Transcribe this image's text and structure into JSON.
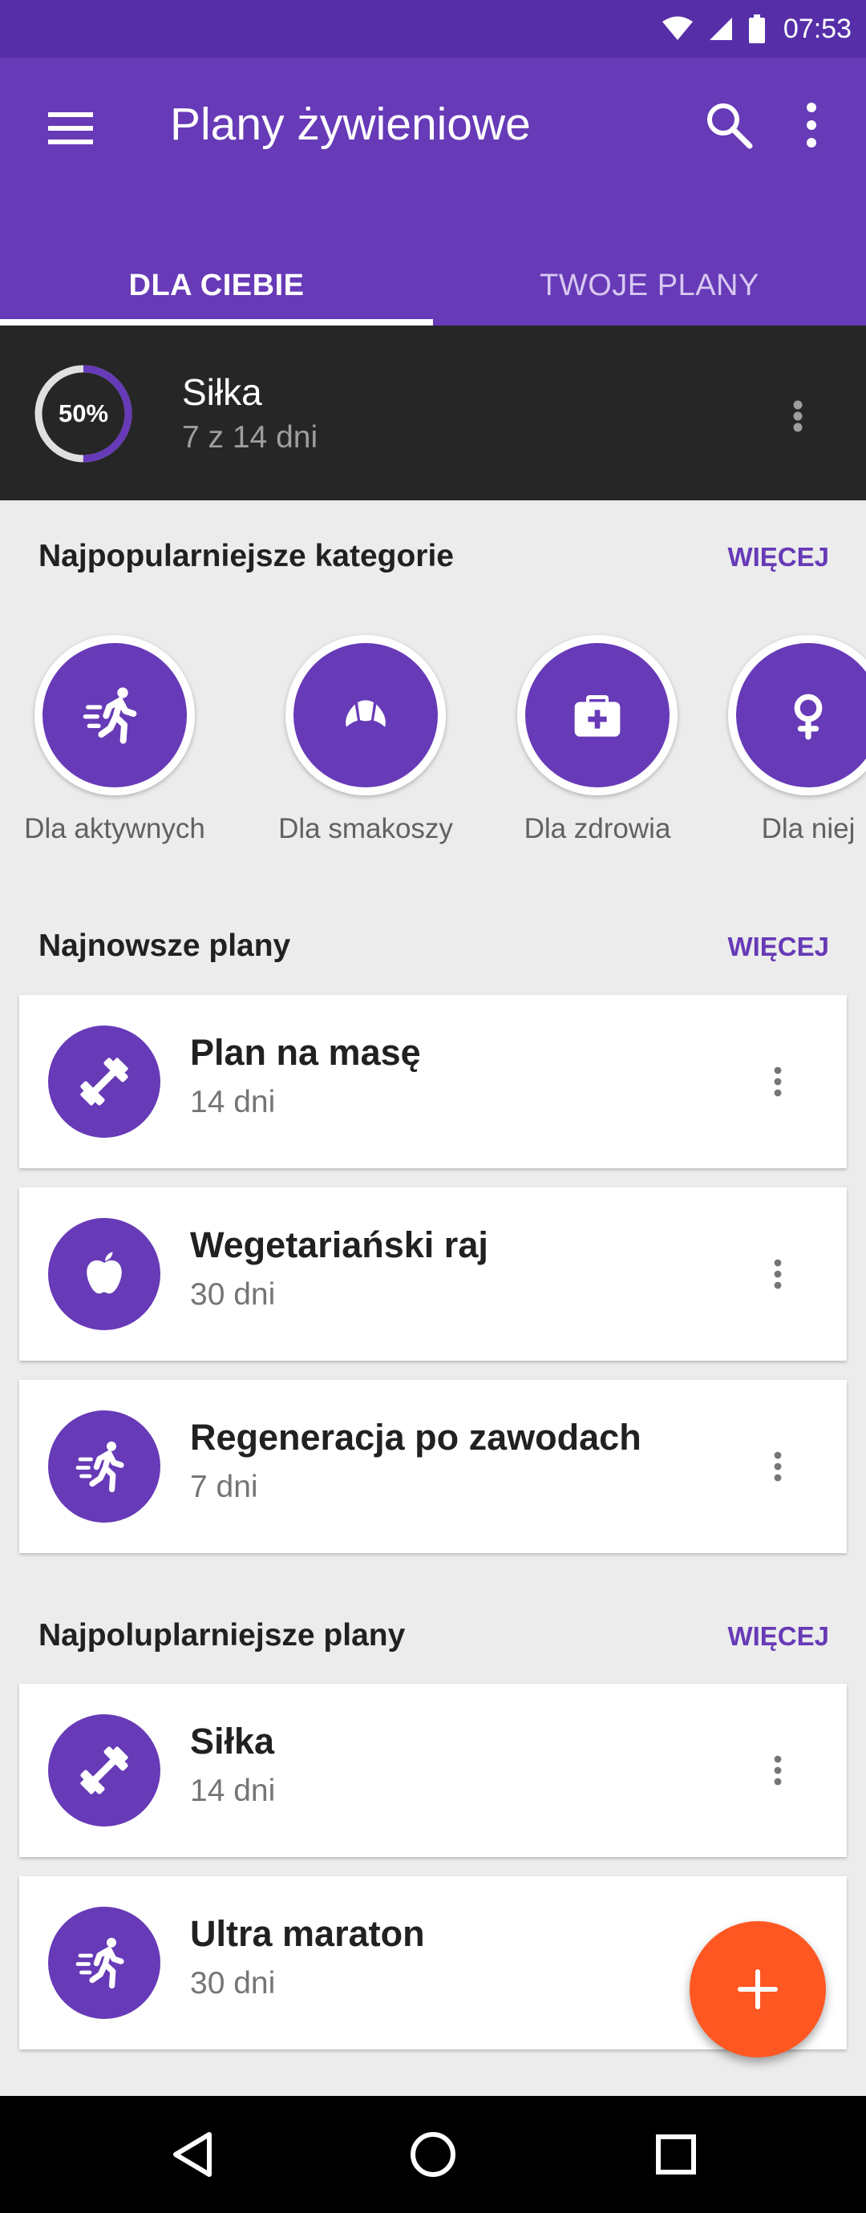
{
  "status_bar": {
    "time": "07:53"
  },
  "app_bar": {
    "title": "Plany żywieniowe",
    "tabs": [
      {
        "label": "DLA CIEBIE",
        "selected": true
      },
      {
        "label": "TWOJE PLANY",
        "selected": false
      }
    ]
  },
  "current_plan": {
    "progress_percent": 50,
    "progress_label": "50%",
    "title": "Siłka",
    "subtitle": "7 z 14 dni"
  },
  "categories": {
    "title": "Najpopularniejsze kategorie",
    "more": "WIĘCEJ",
    "items": [
      {
        "label": "Dla aktywnych",
        "icon": "running-icon"
      },
      {
        "label": "Dla smakoszy",
        "icon": "croissant-icon"
      },
      {
        "label": "Dla zdrowia",
        "icon": "first-aid-kit-icon"
      },
      {
        "label": "Dla niej",
        "icon": "female-icon"
      }
    ]
  },
  "newest": {
    "title": "Najnowsze plany",
    "more": "WIĘCEJ",
    "items": [
      {
        "title": "Plan na masę",
        "subtitle": "14 dni",
        "icon": "dumbbell-icon"
      },
      {
        "title": "Wegetariański raj",
        "subtitle": "30 dni",
        "icon": "apple-icon"
      },
      {
        "title": "Regeneracja po zawodach",
        "subtitle": "7 dni",
        "icon": "running-icon"
      }
    ]
  },
  "popular": {
    "title": "Najpoluplarniejsze plany",
    "more": "WIĘCEJ",
    "items": [
      {
        "title": "Siłka",
        "subtitle": "14 dni",
        "icon": "dumbbell-icon"
      },
      {
        "title": "Ultra maraton",
        "subtitle": "30 dni",
        "icon": "running-icon"
      }
    ]
  },
  "colors": {
    "primary": "#673ab7",
    "primary_dark": "#552ea8",
    "accent": "#ff5722",
    "dark_card": "#262626",
    "background": "#ececec"
  }
}
